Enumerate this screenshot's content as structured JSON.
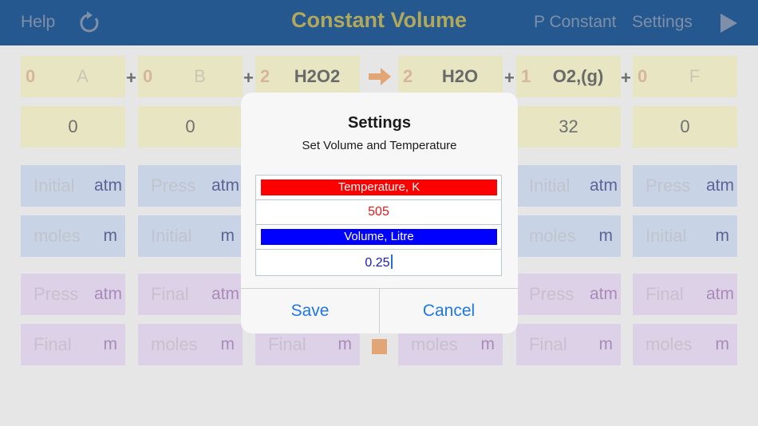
{
  "navbar": {
    "help": "Help",
    "title": "Constant Volume",
    "p_constant": "P Constant",
    "settings": "Settings",
    "icons": {
      "refresh": "refresh-icon",
      "play": "play-icon"
    }
  },
  "equation": {
    "columns": [
      {
        "coef": "0",
        "species": "A",
        "amount": "0",
        "row3_label": "Initial",
        "row3_unit": "atm",
        "row4_label": "moles",
        "row4_unit": "m",
        "row5_label": "Press",
        "row5_unit": "atm",
        "row6_label": "Final",
        "row6_unit": "m"
      },
      {
        "coef": "0",
        "species": "B",
        "amount": "0",
        "row3_label": "Press",
        "row3_unit": "atm",
        "row4_label": "Initial",
        "row4_unit": "m",
        "row5_label": "Final",
        "row5_unit": "atm",
        "row6_label": "moles",
        "row6_unit": "m"
      },
      {
        "coef": "2",
        "species": "H2O2",
        "amount": "",
        "row3_label": "",
        "row3_unit": "",
        "row4_label": "",
        "row4_unit": "",
        "row5_label": "",
        "row5_unit": "",
        "row6_label": "Final",
        "row6_unit": "m"
      },
      {
        "coef": "2",
        "species": "H2O",
        "amount": "",
        "row3_label": "",
        "row3_unit": "",
        "row4_label": "",
        "row4_unit": "",
        "row5_label": "",
        "row5_unit": "",
        "row6_label": "moles",
        "row6_unit": "m"
      },
      {
        "coef": "1",
        "species": "O2,(g)",
        "amount": "32",
        "row3_label": "Initial",
        "row3_unit": "atm",
        "row4_label": "moles",
        "row4_unit": "m",
        "row5_label": "Press",
        "row5_unit": "atm",
        "row6_label": "Final",
        "row6_unit": "m"
      },
      {
        "coef": "0",
        "species": "F",
        "amount": "0",
        "row3_label": "Press",
        "row3_unit": "atm",
        "row4_label": "Initial",
        "row4_unit": "m",
        "row5_label": "Final",
        "row5_unit": "atm",
        "row6_label": "moles",
        "row6_unit": "m"
      }
    ],
    "operators": {
      "plus": "+"
    },
    "arrow_icon": "reaction-arrow-icon"
  },
  "dialog": {
    "title": "Settings",
    "message": "Set Volume and Temperature",
    "temperature_label": "Temperature, K",
    "temperature_value": "505",
    "volume_label": "Volume, Litre",
    "volume_value": "0.25",
    "save": "Save",
    "cancel": "Cancel"
  },
  "colors": {
    "navbar": "#24588f",
    "temperature_bar": "#fe0000",
    "volume_bar": "#0000fe",
    "button_text": "#1f78e6"
  }
}
